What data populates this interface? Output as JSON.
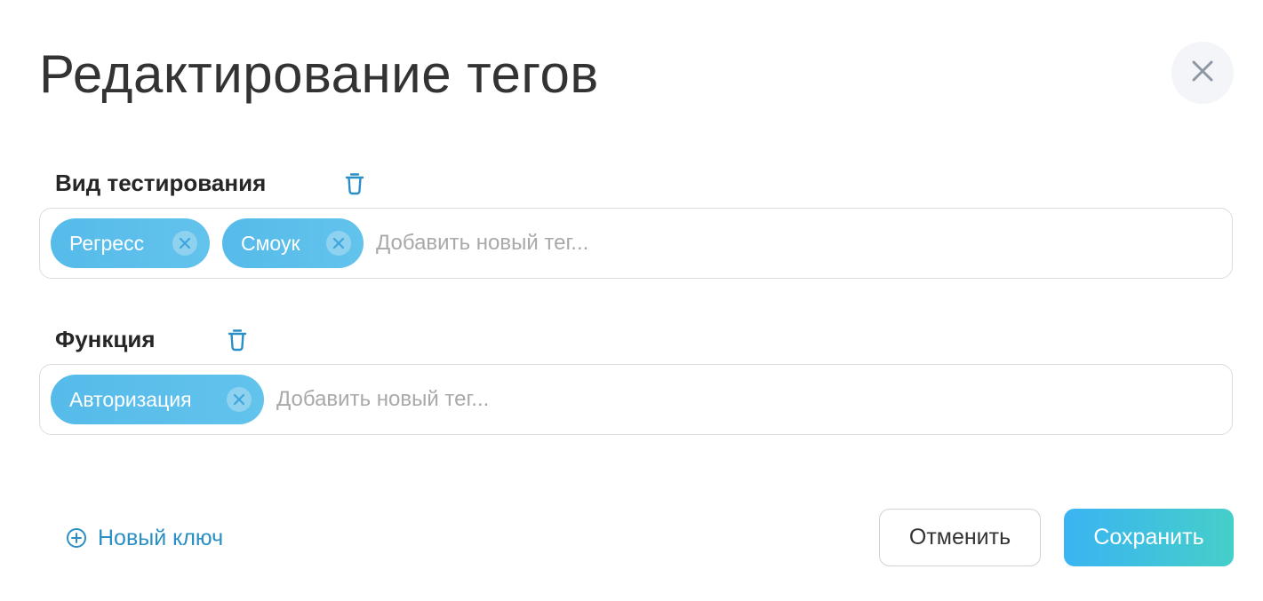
{
  "dialog": {
    "title": "Редактирование тегов"
  },
  "icons": {
    "close": "close-icon",
    "delete": "trash-icon",
    "chip_remove": "x-circle-icon",
    "add": "plus-circle-icon"
  },
  "sections": [
    {
      "label": "Вид тестирования",
      "tags": [
        "Регресс",
        "Смоук"
      ],
      "input_placeholder": "Добавить новый тег..."
    },
    {
      "label": "Функция",
      "tags": [
        "Авторизация"
      ],
      "input_placeholder": "Добавить новый тег..."
    }
  ],
  "footer": {
    "new_key_label": "Новый ключ",
    "cancel_label": "Отменить",
    "save_label": "Сохранить"
  },
  "colors": {
    "accent": "#2a8fc4",
    "chip": "#56bbea",
    "save_gradient_start": "#3ab4f2",
    "save_gradient_end": "#45cfc9"
  }
}
